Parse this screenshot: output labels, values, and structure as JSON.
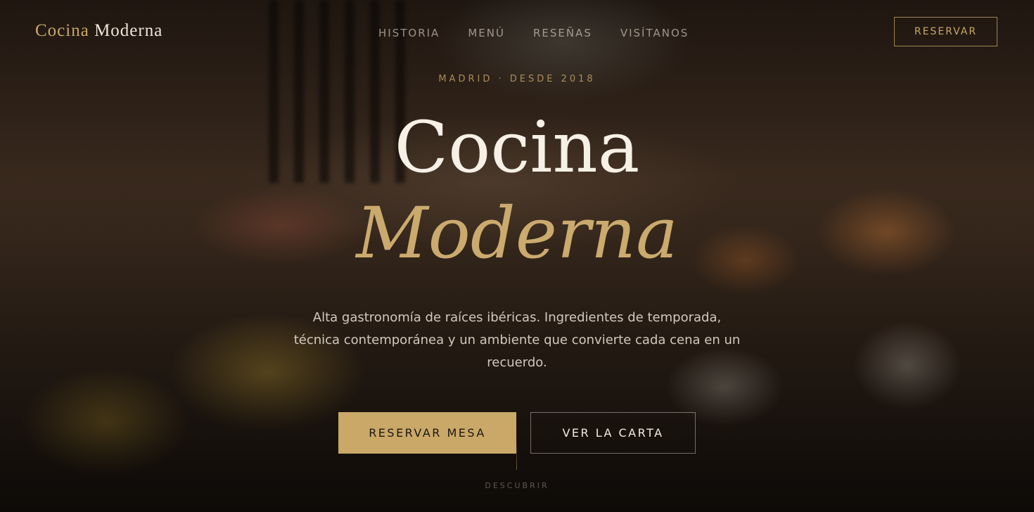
{
  "brand": {
    "name_part1": "Cocina",
    "name_part2": "Moderna"
  },
  "nav": {
    "items": [
      "HISTORIA",
      "MENÚ",
      "RESEÑAS",
      "VISÍTANOS"
    ],
    "reserve_label": "RESERVAR"
  },
  "hero": {
    "eyebrow": "MADRID · DESDE 2018",
    "headline_line1": "Cocina",
    "headline_line2": "Moderna",
    "tagline": "Alta gastronomía de raíces ibéricas. Ingredientes de temporada, técnica contemporánea y un ambiente que convierte cada cena en un recuerdo.",
    "primary_cta": "RESERVAR MESA",
    "secondary_cta": "VER LA CARTA",
    "scroll_hint": "DESCUBRIR"
  },
  "colors": {
    "accent_gold": "#c9a868",
    "text_light": "#f6f0e6",
    "background_dark": "#1a1410"
  }
}
